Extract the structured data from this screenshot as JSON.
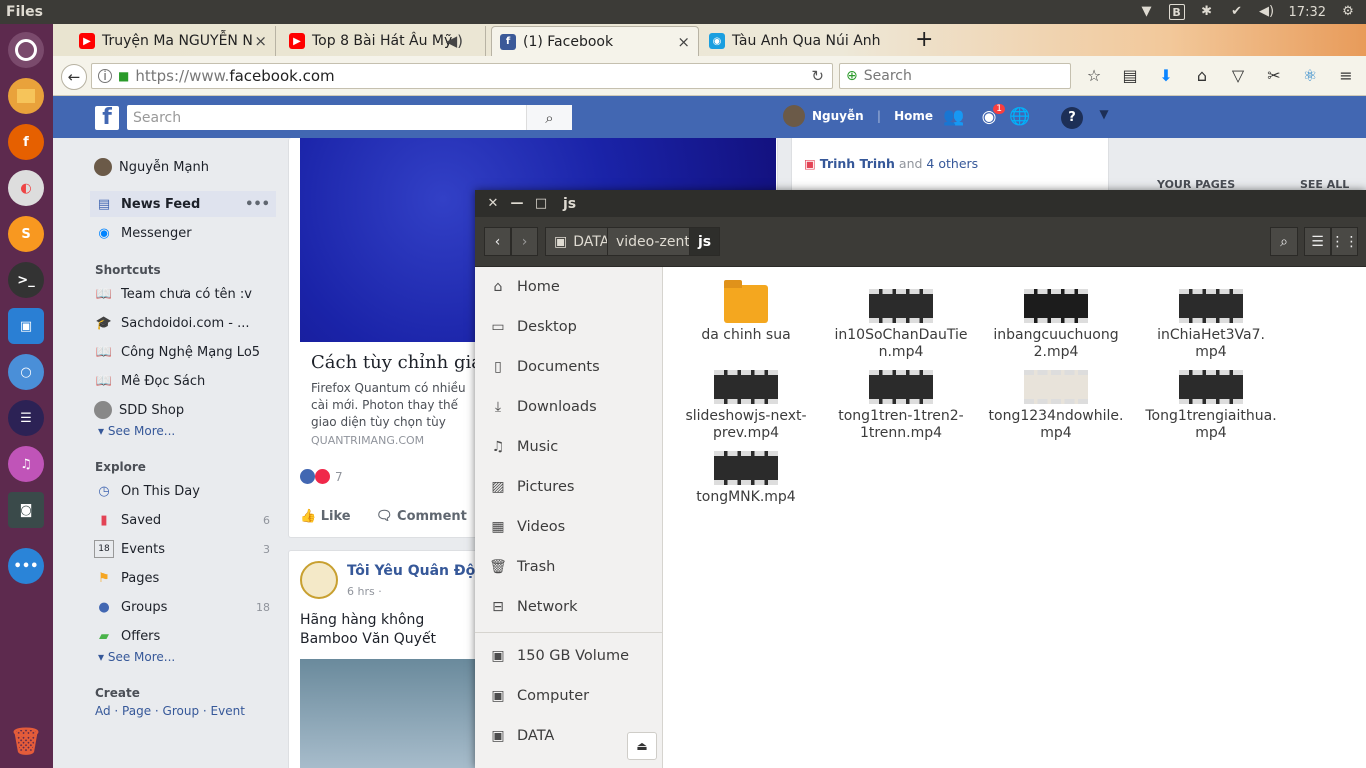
{
  "topbar": {
    "app_name": "Files",
    "time": "17:32"
  },
  "browser": {
    "tabs": [
      {
        "title": "Truyện Ma NGUYỄN N",
        "favicon": "youtube-icon",
        "color": "#ff0000"
      },
      {
        "title": "Top 8 Bài Hát Âu Mỹ",
        "favicon": "youtube-icon",
        "color": "#ff0000"
      },
      {
        "title": "(1) Facebook",
        "favicon": "facebook-icon",
        "color": "#3b5998"
      },
      {
        "title": "Tàu Anh Qua Núi Anh",
        "favicon": "zing-icon",
        "color": "#1a9fe0"
      }
    ],
    "url_prefix": "https://www.",
    "url_domain": "facebook.com",
    "search_placeholder": "Search"
  },
  "facebook": {
    "search_placeholder": "Search",
    "user_short": "Nguyễn",
    "home_label": "Home",
    "notification_count": "1",
    "left_nav": {
      "profile_name": "Nguyễn Mạnh",
      "news_feed": "News Feed",
      "messenger": "Messenger",
      "shortcuts_header": "Shortcuts",
      "shortcuts": [
        "Team chưa có tên :v",
        "Sachdoidoi.com - ...",
        "Công Nghệ Mạng Lo5",
        "Mê Đọc Sách",
        "SDD Shop"
      ],
      "see_more": "See More...",
      "explore_header": "Explore",
      "explore": [
        {
          "label": "On This Day",
          "count": ""
        },
        {
          "label": "Saved",
          "count": "6"
        },
        {
          "label": "Events",
          "count": "3"
        },
        {
          "label": "Pages",
          "count": ""
        },
        {
          "label": "Groups",
          "count": "18"
        },
        {
          "label": "Offers",
          "count": ""
        }
      ],
      "create_header": "Create",
      "create_links": "Ad · Page · Group · Event"
    },
    "post1": {
      "title": "Cách tùy chỉnh giao d",
      "desc": "Firefox Quantum có nhiều cài mới. Photon thay thế giao diện tùy chọn tùy chỉnh. Bài viết này",
      "source": "QUANTRIMANG.COM",
      "reactions": "7",
      "like": "Like",
      "comment": "Comment"
    },
    "post2": {
      "page": "Tôi Yêu Quân Đội N",
      "time": "6 hrs · ",
      "text": "Hãng hàng không Bamboo Văn Quyết"
    },
    "right": {
      "friend_name": "Trinh Trinh",
      "and": " and ",
      "others": "4 others",
      "your_pages": "YOUR PAGES",
      "see_all": "SEE ALL"
    }
  },
  "files": {
    "window_title": "js",
    "breadcrumbs": [
      "DATA",
      "video-zent",
      "js"
    ],
    "sidebar": [
      "Home",
      "Desktop",
      "Documents",
      "Downloads",
      "Music",
      "Pictures",
      "Videos",
      "Trash",
      "Network"
    ],
    "devices": [
      "150 GB Volume",
      "Computer",
      "DATA"
    ],
    "items": [
      {
        "name": "da chinh sua",
        "type": "folder"
      },
      {
        "name": "in10SoChanDauTien.mp4",
        "line1": "in10SoChanDauTie",
        "line2": "n.mp4",
        "type": "video"
      },
      {
        "name": "inbangcuuchuong2.mp4",
        "line1": "inbangcuuchuong",
        "line2": "2.mp4",
        "type": "video"
      },
      {
        "name": "inChiaHet3Va7.mp4",
        "line1": "inChiaHet3Va7.",
        "line2": "mp4",
        "type": "video"
      },
      {
        "name": "slideshowjs-next-prev.mp4",
        "line1": "slideshowjs-next-",
        "line2": "prev.mp4",
        "type": "video"
      },
      {
        "name": "tong1tren-1tren2-1trenn.mp4",
        "line1": "tong1tren-1tren2-",
        "line2": "1trenn.mp4",
        "type": "video"
      },
      {
        "name": "tong1234ndowhile.mp4",
        "line1": "tong1234ndowhile.",
        "line2": "mp4",
        "type": "video"
      },
      {
        "name": "Tong1trengiaithua.mp4",
        "line1": "Tong1trengiaithua.",
        "line2": "mp4",
        "type": "video"
      },
      {
        "name": "tongMNK.mp4",
        "line1": "tongMNK.mp4",
        "line2": "",
        "type": "video"
      }
    ]
  },
  "colors": {
    "fb_blue": "#4267b2",
    "launcher": "#5d2a4e",
    "files_dark": "#3c3b37"
  }
}
